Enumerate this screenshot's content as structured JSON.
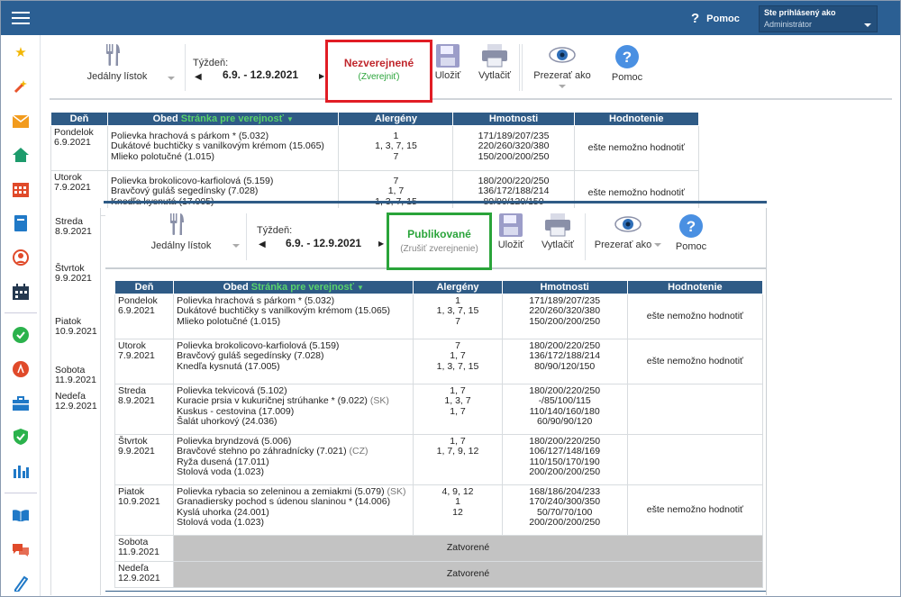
{
  "topbar": {
    "help": "Pomoc",
    "user_label": "Ste prihlásený ako",
    "user_role": "Administrátor"
  },
  "sidebar": {
    "icons": [
      "star-icon",
      "magic-wand-icon",
      "mail-icon",
      "home-icon",
      "calendar-grid-icon",
      "notebook-icon",
      "person-icon",
      "calendar-icon",
      "check-circle-icon",
      "alert-circle-icon",
      "briefcase-icon",
      "shield-check-icon",
      "bar-chart-icon",
      "book-open-icon",
      "chat-icon",
      "pen-icon"
    ]
  },
  "toolbar": {
    "menu_label": "Jedálny lístok",
    "week_label": "Týždeň:",
    "week_range": "6.9. - 12.9.2021",
    "save": "Uložiť",
    "print": "Vytlačiť",
    "view_as": "Prezerať ako",
    "help": "Pomoc"
  },
  "status_unpublished": {
    "title": "Nezverejnené",
    "action": "(Zverejniť)"
  },
  "status_published": {
    "title": "Publikované",
    "action": "(Zrušiť zverejnenie)"
  },
  "table": {
    "headers": {
      "day": "Deň",
      "lunch": "Obed",
      "public_link": "Stránka pre verejnosť",
      "allergens": "Alergény",
      "weights": "Hmotnosti",
      "rating": "Hodnotenie"
    },
    "closed": "Zatvorené",
    "not_rateable": "ešte nemožno hodnotiť"
  },
  "days": [
    {
      "name": "Pondelok",
      "date": "6.9.2021",
      "meals": [
        "Polievka hrachová s párkom * (5.032)",
        "Dukátové buchtičky s vanilkovým krémom (15.065)",
        "Mlieko polotučné (1.015)"
      ],
      "allergens": [
        "1",
        "1, 3, 7, 15",
        "7"
      ],
      "weights": [
        "171/189/207/235",
        "220/260/320/380",
        "150/200/200/250"
      ]
    },
    {
      "name": "Utorok",
      "date": "7.9.2021",
      "meals": [
        "Polievka brokolicovo-karfiolová (5.159)",
        "Bravčový guláš segedínsky (7.028)",
        "Knedľa kysnutá (17.005)"
      ],
      "allergens": [
        "7",
        "1, 7",
        "1, 3, 7, 15"
      ],
      "weights": [
        "180/200/220/250",
        "136/172/188/214",
        "80/90/120/150"
      ]
    },
    {
      "name": "Streda",
      "date": "8.9.2021",
      "meals": [
        "Polievka tekvicová (5.102)",
        "Kuracie prsia v kukuričnej strúhanke * (9.022)",
        "Kuskus - cestovina (17.009)",
        "Šalát uhorkový (24.036)"
      ],
      "meal_tag": "(SK)",
      "allergens": [
        "1, 7",
        "1, 3, 7",
        "1, 7",
        ""
      ],
      "weights": [
        "180/200/220/250",
        "-/85/100/115",
        "110/140/160/180",
        "60/90/90/120"
      ]
    },
    {
      "name": "Štvrtok",
      "date": "9.9.2021",
      "meals": [
        "Polievka bryndzová (5.006)",
        "Bravčové stehno po záhradnícky (7.021)",
        "Ryža dusená (17.011)",
        "Stolová voda (1.023)"
      ],
      "meal_tag": "(CZ)",
      "allergens": [
        "1, 7",
        "1, 7, 9, 12",
        "",
        ""
      ],
      "weights": [
        "180/200/220/250",
        "106/127/148/169",
        "110/150/170/190",
        "200/200/200/250"
      ]
    },
    {
      "name": "Piatok",
      "date": "10.9.2021",
      "meals": [
        "Polievka rybacia so zeleninou a zemiakmi (5.079)",
        "Granadiersky pochod s údenou slaninou * (14.006)",
        "Kyslá uhorka (24.001)",
        "Stolová voda (1.023)"
      ],
      "meal_tag": "(SK)",
      "allergens": [
        "4, 9, 12",
        "1",
        "12",
        ""
      ],
      "weights": [
        "168/186/204/233",
        "170/240/300/350",
        "50/70/70/100",
        "200/200/200/250"
      ]
    },
    {
      "name": "Sobota",
      "date": "11.9.2021"
    },
    {
      "name": "Nedeľa",
      "date": "12.9.2021"
    }
  ],
  "back_table": {
    "rows": [
      {
        "name": "Pondelok",
        "date": "6.9.2021",
        "meals": [
          "Polievka hrachová s párkom * (5.032)",
          "Dukátové buchtičky s vanilkovým krémom (15.065)",
          "Mlieko polotučné (1.015)"
        ],
        "allergens": [
          "1",
          "1, 3, 7, 15",
          "7"
        ],
        "weights": [
          "171/189/207/235",
          "220/260/320/380",
          "150/200/200/250"
        ]
      },
      {
        "name": "Utorok",
        "date": "7.9.2021",
        "meals": [
          "Polievka brokolicovo-karfiolová (5.159)",
          "Bravčový guláš segedínsky (7.028)",
          "Knedľa kysnutá (17.005)"
        ],
        "allergens": [
          "7",
          "1, 7",
          "1, 3, 7, 15"
        ],
        "weights": [
          "180/200/220/250",
          "136/172/188/214",
          "80/90/120/150"
        ]
      }
    ],
    "extra_days": [
      {
        "name": "Streda",
        "date": "8.9.2021"
      },
      {
        "name": "Štvrtok",
        "date": "9.9.2021"
      },
      {
        "name": "Piatok",
        "date": "10.9.2021"
      },
      {
        "name": "Sobota",
        "date": "11.9.2021"
      },
      {
        "name": "Nedeľa",
        "date": "12.9.2021"
      }
    ]
  }
}
